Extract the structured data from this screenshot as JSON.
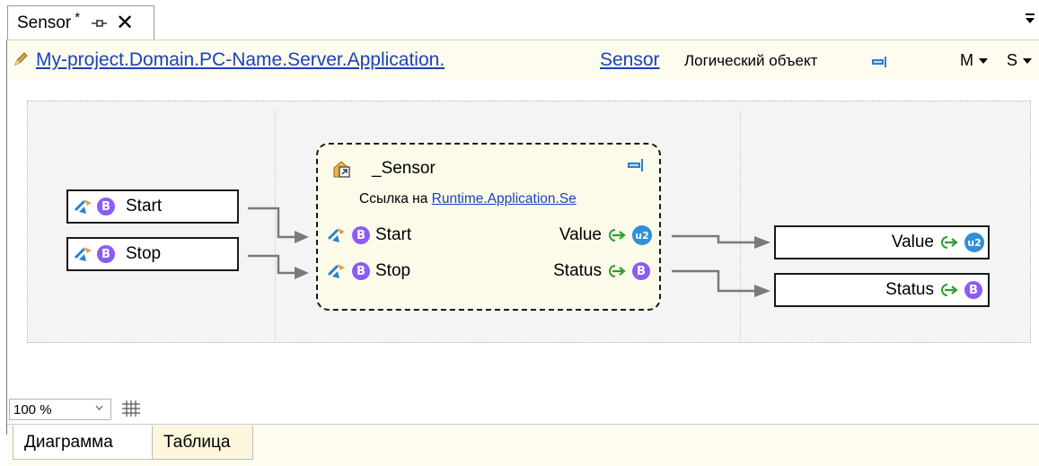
{
  "tab": {
    "title": "Sensor",
    "modified_mark": "*"
  },
  "breadcrumb": {
    "path_link": "My-project.Domain.PC-Name.Server.Application.",
    "object_link": "Sensor",
    "object_type": "Логический объект",
    "dropdown_m": "M",
    "dropdown_s": "S"
  },
  "inputs": [
    {
      "label": "Start",
      "badge": "B"
    },
    {
      "label": "Stop",
      "badge": "B"
    }
  ],
  "block": {
    "title": "_Sensor",
    "ref_prefix": "Ссылка на",
    "ref_link": "Runtime.Application.Se",
    "in_ports": [
      {
        "label": "Start",
        "badge": "B"
      },
      {
        "label": "Stop",
        "badge": "B"
      }
    ],
    "out_ports": [
      {
        "label": "Value",
        "badge": "u2"
      },
      {
        "label": "Status",
        "badge": "B"
      }
    ]
  },
  "outputs": [
    {
      "label": "Value",
      "badge": "u2"
    },
    {
      "label": "Status",
      "badge": "B"
    }
  ],
  "zoom": {
    "value": "100 %"
  },
  "bottom_tabs": [
    {
      "label": "Диаграмма",
      "active": true
    },
    {
      "label": "Таблица",
      "active": false
    }
  ],
  "colors": {
    "accent_link": "#1a43b8",
    "badge_b": "#8b5cf6",
    "badge_u2": "#2f8fd8",
    "arrow_green": "#2e9e2e",
    "panel_bg": "#fdfcef"
  }
}
